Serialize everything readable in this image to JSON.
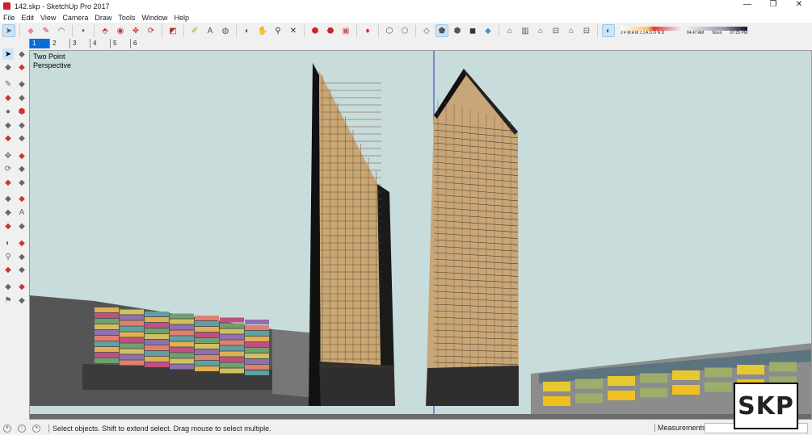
{
  "window": {
    "title": "142.skp - SketchUp Pro 2017",
    "minimize": "—",
    "restore": "❐",
    "close": "✕"
  },
  "menu": [
    "File",
    "Edit",
    "View",
    "Camera",
    "Draw",
    "Tools",
    "Window",
    "Help"
  ],
  "toolbar": {
    "icons": [
      "select-icon",
      "eraser-icon",
      "pencil-icon",
      "arc-icon",
      "rectangle-icon",
      "push-pull-icon",
      "follow-me-icon",
      "move-icon",
      "rotate-icon",
      "scale-icon",
      "tape-measure-icon",
      "text-icon",
      "paint-bucket-icon",
      "orbit-icon",
      "pan-icon",
      "zoom-icon",
      "zoom-extents-icon",
      "warehouse-icon",
      "extension-icon",
      "send-icon",
      "ruby-icon",
      "xray-icon",
      "back-edges-icon",
      "wireframe-icon",
      "hidden-line-icon",
      "shaded-icon",
      "shaded-textures-icon",
      "monochrome-icon",
      "iso-view-icon",
      "top-view-icon",
      "front-view-icon",
      "right-view-icon",
      "back-view-icon",
      "left-view-icon",
      "shadows-toggle-icon"
    ],
    "shadow_months": "J F M A M J J A S O N D",
    "shadow_time_start": "04:47 AM",
    "shadow_time_mid": "Noon",
    "shadow_time_end": "07:25 PM"
  },
  "scenes": [
    "1",
    "2",
    "3",
    "4",
    "5",
    "6"
  ],
  "active_scene": "1",
  "viewport": {
    "camera_label_line1": "Two Point",
    "camera_label_line2": "Perspective",
    "sky_color": "#c9dcdc"
  },
  "status": {
    "message": "Select objects. Shift to extend select. Drag mouse to select multiple.",
    "measurements_label": "Measurements",
    "measurements_value": ""
  },
  "watermark": "SKP"
}
